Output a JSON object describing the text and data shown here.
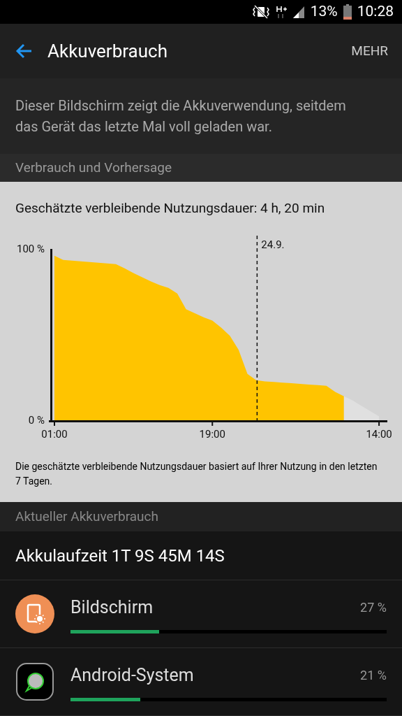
{
  "status_bar": {
    "battery_text": "13%",
    "time": "10:28"
  },
  "header": {
    "title": "Akkuverbrauch",
    "action": "MEHR"
  },
  "description": "Dieser Bildschirm zeigt die Akkuverwendung, seitdem das Gerät das letzte Mal voll geladen war.",
  "section_1": "Verbrauch und Vorhersage",
  "forecast": {
    "title": "Geschätzte verbleibende Nutzungsdauer: 4 h, 20 min",
    "chart_data": {
      "type": "area",
      "categories": [
        "01:00",
        null,
        null,
        null,
        null,
        null,
        null,
        null,
        null,
        null,
        null,
        null,
        null,
        null,
        null,
        null,
        null,
        null,
        "19:00",
        null,
        null,
        null,
        null,
        null,
        null,
        null,
        null,
        null,
        null,
        null,
        null,
        null,
        null,
        null,
        null,
        null,
        null,
        "14:00"
      ],
      "series": [
        {
          "color": "#ffc400",
          "values": [
            96,
            93.6,
            93.2,
            92.8,
            92.3,
            91.9,
            91.5,
            91.1,
            88.7,
            85.9,
            83.5,
            81,
            78.9,
            77.2,
            74,
            64.8,
            62.4,
            60.1,
            58.2,
            54.1,
            49.3,
            41,
            27,
            23.4,
            22.7,
            22.3,
            21.9,
            21.6,
            21.2,
            20.8,
            20.5,
            20.1,
            16.5,
            14,
            null,
            null,
            null,
            null
          ]
        },
        {
          "color": "#e0e0e0",
          "values": [
            null,
            null,
            null,
            null,
            null,
            null,
            null,
            null,
            null,
            null,
            null,
            null,
            null,
            null,
            null,
            null,
            null,
            null,
            null,
            null,
            null,
            null,
            null,
            null,
            null,
            null,
            null,
            null,
            null,
            null,
            null,
            null,
            null,
            14,
            11.5,
            8.4,
            5.3,
            2.2
          ]
        }
      ],
      "yticks": [
        {
          "value": 0,
          "label": "0 %"
        },
        {
          "value": 100,
          "label": "100 %"
        }
      ],
      "ylim": [
        0,
        100
      ],
      "annotations": [
        "24.9."
      ]
    },
    "note": "Die geschätzte verbleibende Nutzungsdauer basiert auf Ihrer Nutzung in den letzten 7 Tagen."
  },
  "section_2": "Aktueller Akkuverbrauch",
  "battery_time": "Akkulaufzeit 1T 9S 45M 14S",
  "apps": [
    {
      "kind": "screen",
      "name": "Bildschirm",
      "percent": "27 %",
      "level": 0.28
    },
    {
      "kind": "system",
      "name": "Android-System",
      "percent": "21 %",
      "level": 0.22
    }
  ]
}
